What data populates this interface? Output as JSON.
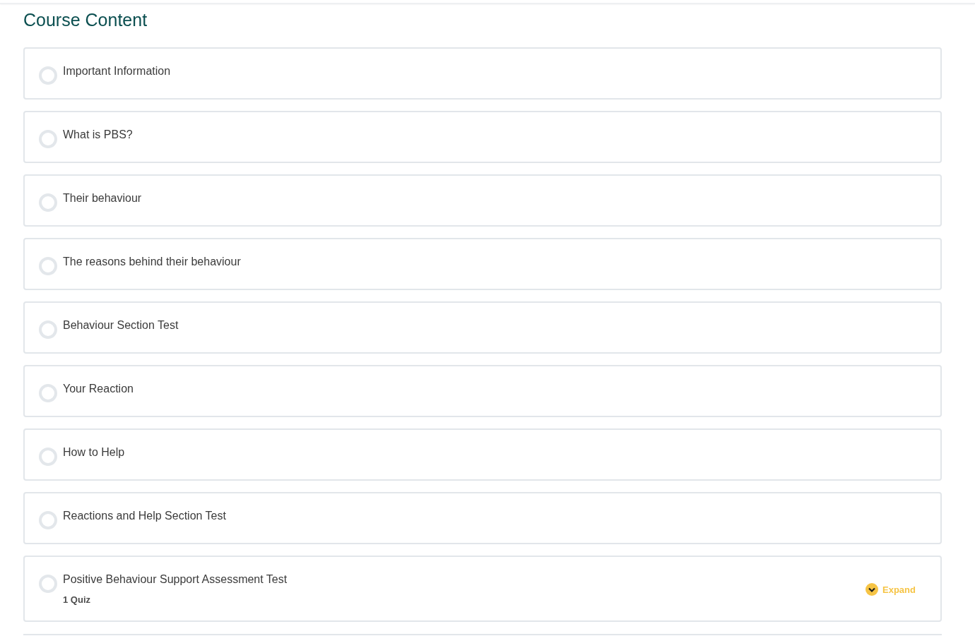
{
  "page_title": "Course Content",
  "lessons": [
    {
      "title": "Important Information",
      "completed": false
    },
    {
      "title": "What is PBS?",
      "completed": false
    },
    {
      "title": "Their behaviour",
      "completed": false
    },
    {
      "title": "The reasons behind their behaviour",
      "completed": false
    },
    {
      "title": "Behaviour Section Test",
      "completed": false
    },
    {
      "title": "Your Reaction",
      "completed": false
    },
    {
      "title": "How to Help",
      "completed": false
    },
    {
      "title": "Reactions and Help Section Test",
      "completed": false
    },
    {
      "title": "Positive Behaviour Support Assessment Test",
      "completed": false,
      "meta": "1 Quiz",
      "expand": {
        "label": "Expand",
        "expanded": false
      }
    }
  ]
}
